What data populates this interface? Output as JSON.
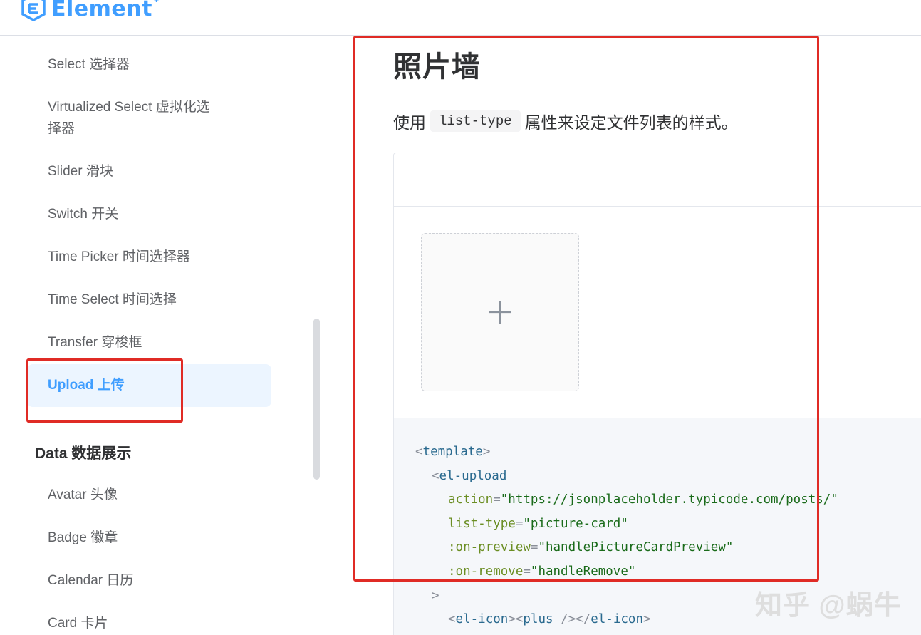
{
  "header": {
    "logo_text": "Element",
    "logo_sup": "+"
  },
  "sidebar": {
    "items": [
      {
        "label": "Select 选择器"
      },
      {
        "label": "Virtualized Select 虚拟化选择器",
        "line1": "Virtualized Select 虚拟化选",
        "line2": "择器"
      },
      {
        "label": "Slider 滑块"
      },
      {
        "label": "Switch 开关"
      },
      {
        "label": "Time Picker 时间选择器"
      },
      {
        "label": "Time Select 时间选择"
      },
      {
        "label": "Transfer 穿梭框"
      },
      {
        "label": "Upload 上传",
        "active": true
      }
    ],
    "group_title": "Data 数据展示",
    "group_items": [
      {
        "label": "Avatar 头像"
      },
      {
        "label": "Badge 徽章"
      },
      {
        "label": "Calendar 日历"
      },
      {
        "label": "Card 卡片"
      }
    ]
  },
  "main": {
    "title": "照片墙",
    "desc_before": "使用",
    "desc_code": "list-type",
    "desc_after": "属性来设定文件列表的样式。",
    "code": {
      "l1_tag": "template",
      "l2_tag": "el-upload",
      "l3_attr": "action",
      "l3_val": "\"https://jsonplaceholder.typicode.com/posts/\"",
      "l4_attr": "list-type",
      "l4_val": "\"picture-card\"",
      "l5_attr": ":on-preview",
      "l5_val": "\"handlePictureCardPreview\"",
      "l6_attr": ":on-remove",
      "l6_val": "\"handleRemove\"",
      "l7": ">",
      "l8_tag": "el-icon",
      "l8_inner": "plus",
      "l8_close": "el-icon"
    }
  },
  "watermark": "知乎 @蜗牛",
  "colors": {
    "accent": "#409eff",
    "annotation": "#e02b25"
  }
}
